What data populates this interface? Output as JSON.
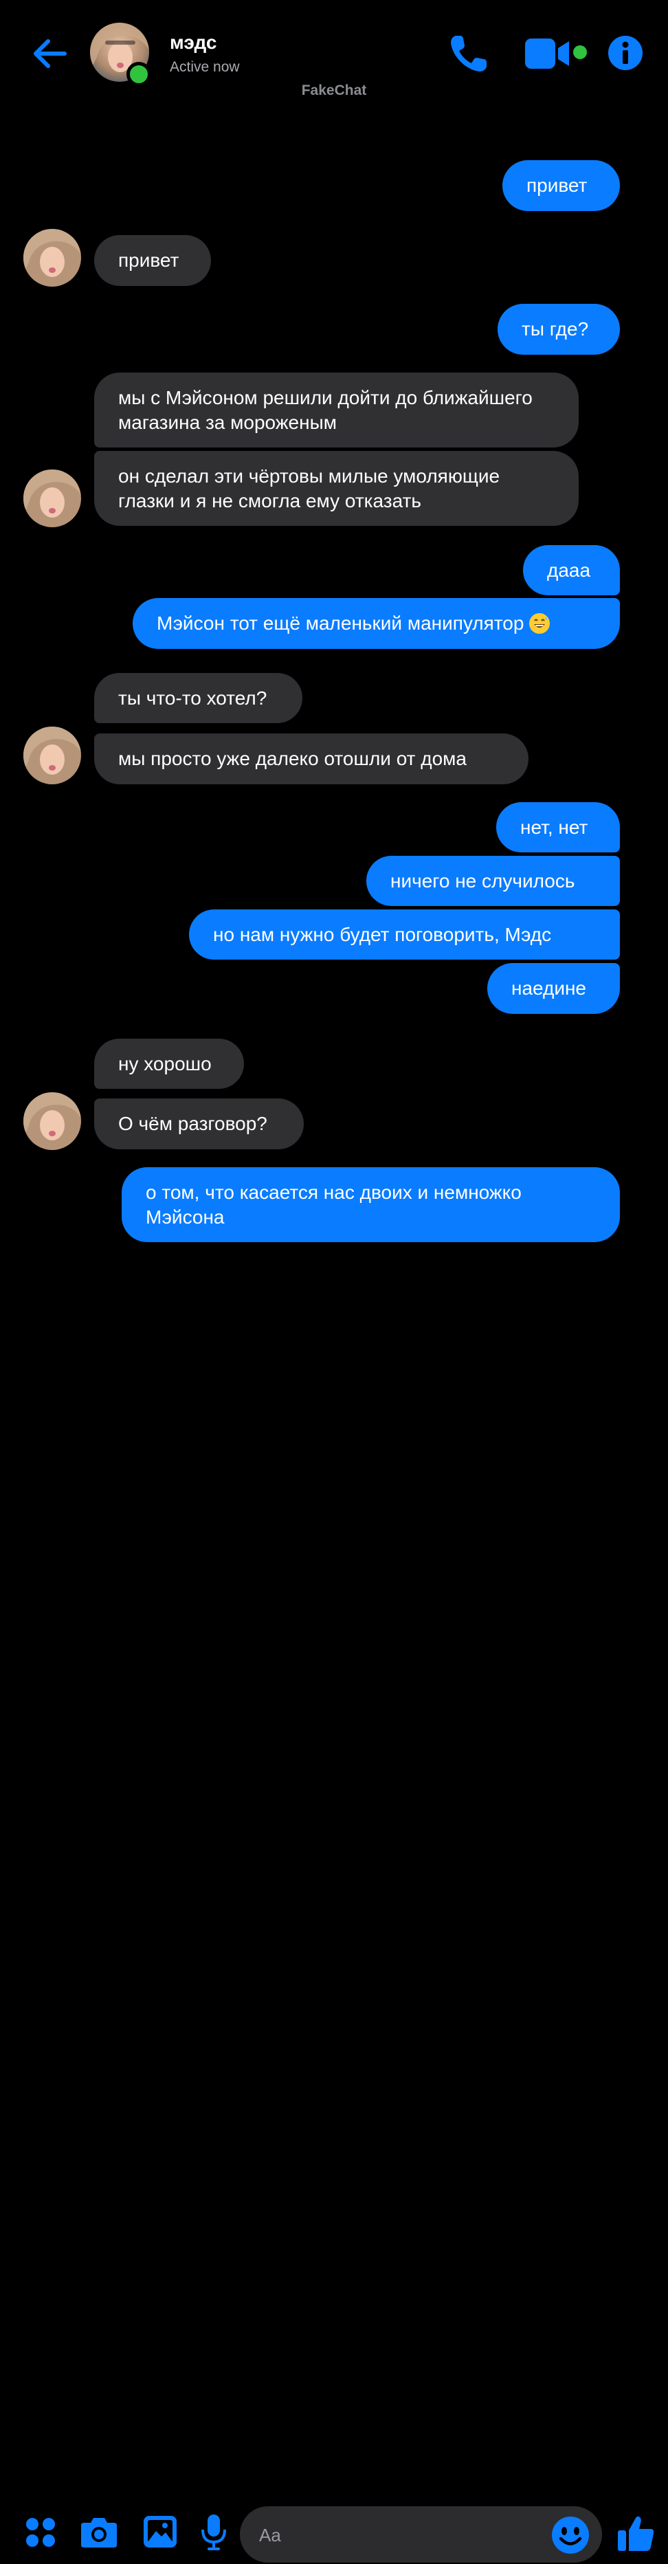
{
  "header": {
    "contact_name": "мэдс",
    "status": "Active now",
    "watermark": "FakeChat",
    "icons": {
      "back": "arrow-left-icon",
      "call": "phone-icon",
      "video": "video-camera-icon",
      "info": "info-icon"
    }
  },
  "colors": {
    "accent": "#0a7cff",
    "incoming_bubble": "#303033",
    "online": "#31c33e",
    "background": "#000000"
  },
  "messages": [
    {
      "from": "me",
      "text": "привет"
    },
    {
      "from": "them",
      "text": "привет"
    },
    {
      "from": "me",
      "text": "ты где?"
    },
    {
      "from": "them",
      "text": "мы с Мэйсоном решили дойти до ближайшего магазина за мороженым"
    },
    {
      "from": "them",
      "text": "он сделал эти чёртовы милые умоляющие глазки и я не смогла ему отказать"
    },
    {
      "from": "me",
      "text": "дааа"
    },
    {
      "from": "me",
      "text": "Мэйсон тот ещё маленький манипулятор",
      "emoji": "grinning-sweat-emoji"
    },
    {
      "from": "them",
      "text": "ты что-то хотел?"
    },
    {
      "from": "them",
      "text": "мы просто уже далеко отошли от дома"
    },
    {
      "from": "me",
      "text": "нет, нет"
    },
    {
      "from": "me",
      "text": "ничего не случилось"
    },
    {
      "from": "me",
      "text": "но нам нужно будет поговорить, Мэдс"
    },
    {
      "from": "me",
      "text": "наедине"
    },
    {
      "from": "them",
      "text": "ну хорошо"
    },
    {
      "from": "them",
      "text": "О чём разговор?"
    },
    {
      "from": "me",
      "text": "о том, что касается нас двоих и немножко Мэйсона"
    }
  ],
  "composer": {
    "placeholder": "Aa",
    "icons": {
      "menu": "four-dots-icon",
      "camera": "camera-icon",
      "gallery": "image-icon",
      "mic": "microphone-icon",
      "emoji": "smiley-icon",
      "like": "thumbs-up-icon"
    }
  }
}
